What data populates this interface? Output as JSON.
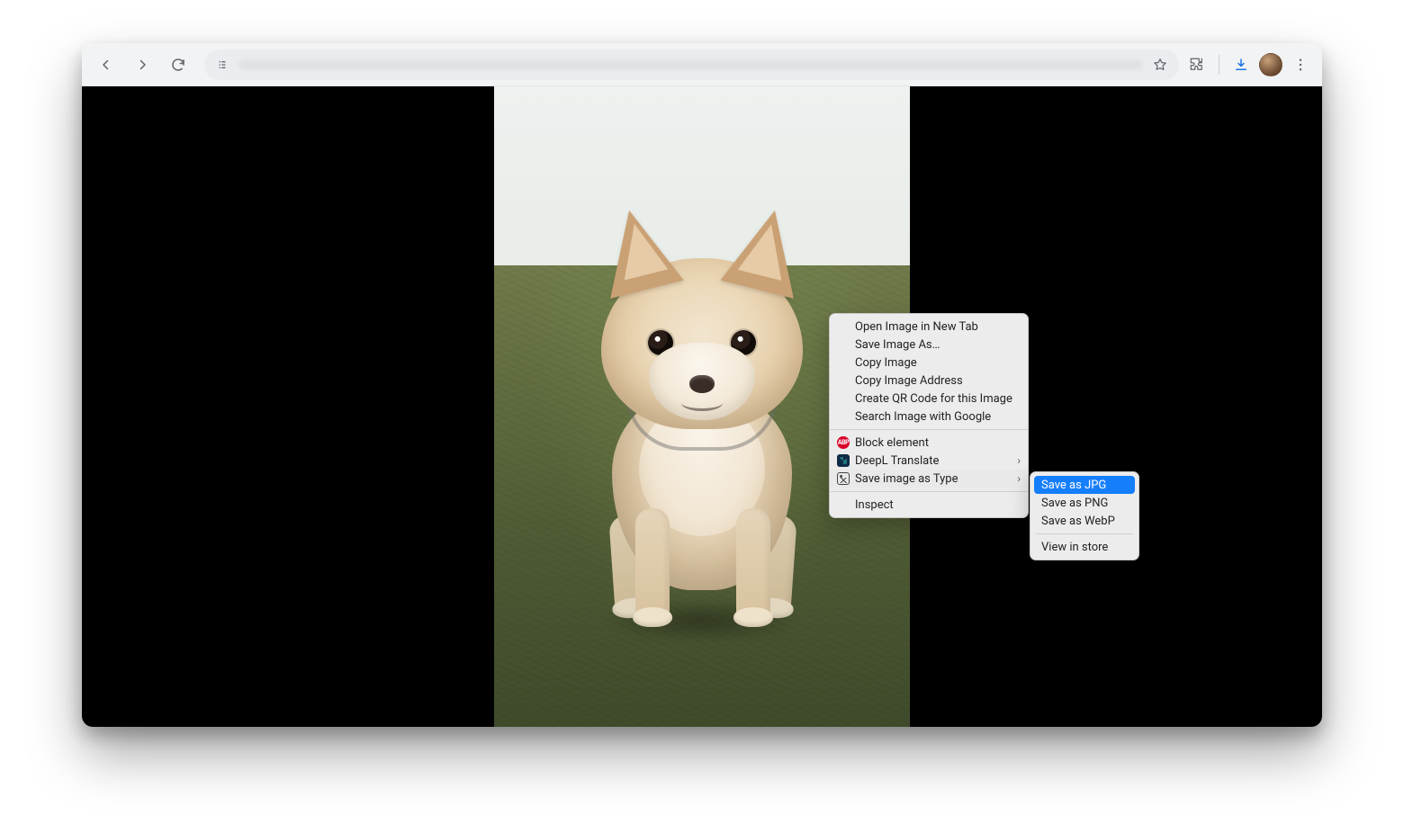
{
  "context_menu": {
    "group1": [
      "Open Image in New Tab",
      "Save Image As…",
      "Copy Image",
      "Copy Image Address",
      "Create QR Code for this Image",
      "Search Image with Google"
    ],
    "ext_block": "Block element",
    "ext_deepl": "DeepL Translate",
    "ext_saveas": "Save image as Type",
    "inspect": "Inspect"
  },
  "submenu": {
    "jpg": "Save as JPG",
    "png": "Save as PNG",
    "webp": "Save as WebP",
    "store": "View in store"
  },
  "icons": {
    "abp": "ABP"
  },
  "image": {
    "alt": "chihuahua-dog-on-grass"
  }
}
